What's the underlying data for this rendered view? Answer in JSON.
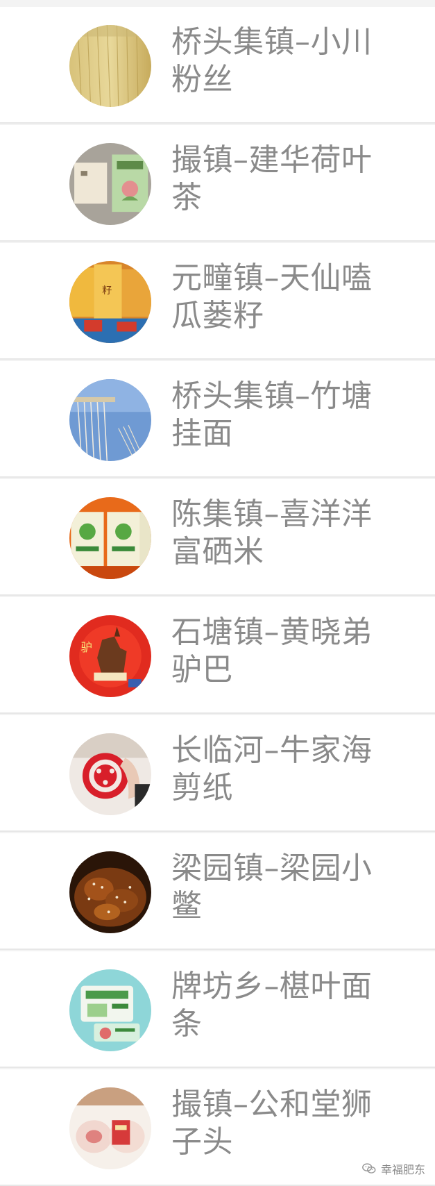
{
  "items": [
    {
      "title": "桥头集镇–小川粉丝",
      "icon": "vermicelli-photo"
    },
    {
      "title": "撮镇–建华荷叶茶",
      "icon": "lotus-tea-photo"
    },
    {
      "title": "元疃镇–天仙嗑瓜蒌籽",
      "icon": "melon-seeds-photo"
    },
    {
      "title": "桥头集镇–竹塘挂面",
      "icon": "hanging-noodles-photo"
    },
    {
      "title": "陈集镇–喜洋洋富硒米",
      "icon": "selenium-rice-photo"
    },
    {
      "title": "石塘镇–黄晓弟驴巴",
      "icon": "donkey-meat-photo"
    },
    {
      "title": "长临河–牛家海剪纸",
      "icon": "paper-cutting-photo"
    },
    {
      "title": "梁园镇–梁园小鳖",
      "icon": "turtle-dish-photo"
    },
    {
      "title": "牌坊乡–椹叶面条",
      "icon": "mulberry-noodles-photo"
    },
    {
      "title": "撮镇–公和堂狮子头",
      "icon": "lion-head-photo"
    }
  ],
  "watermark": {
    "text": "幸福肥东",
    "icon": "wechat-icon"
  },
  "colors": {
    "background": "#f3f3f3",
    "card": "#ffffff",
    "text": "#8a8a8a",
    "divider": "#e7e7e7"
  }
}
